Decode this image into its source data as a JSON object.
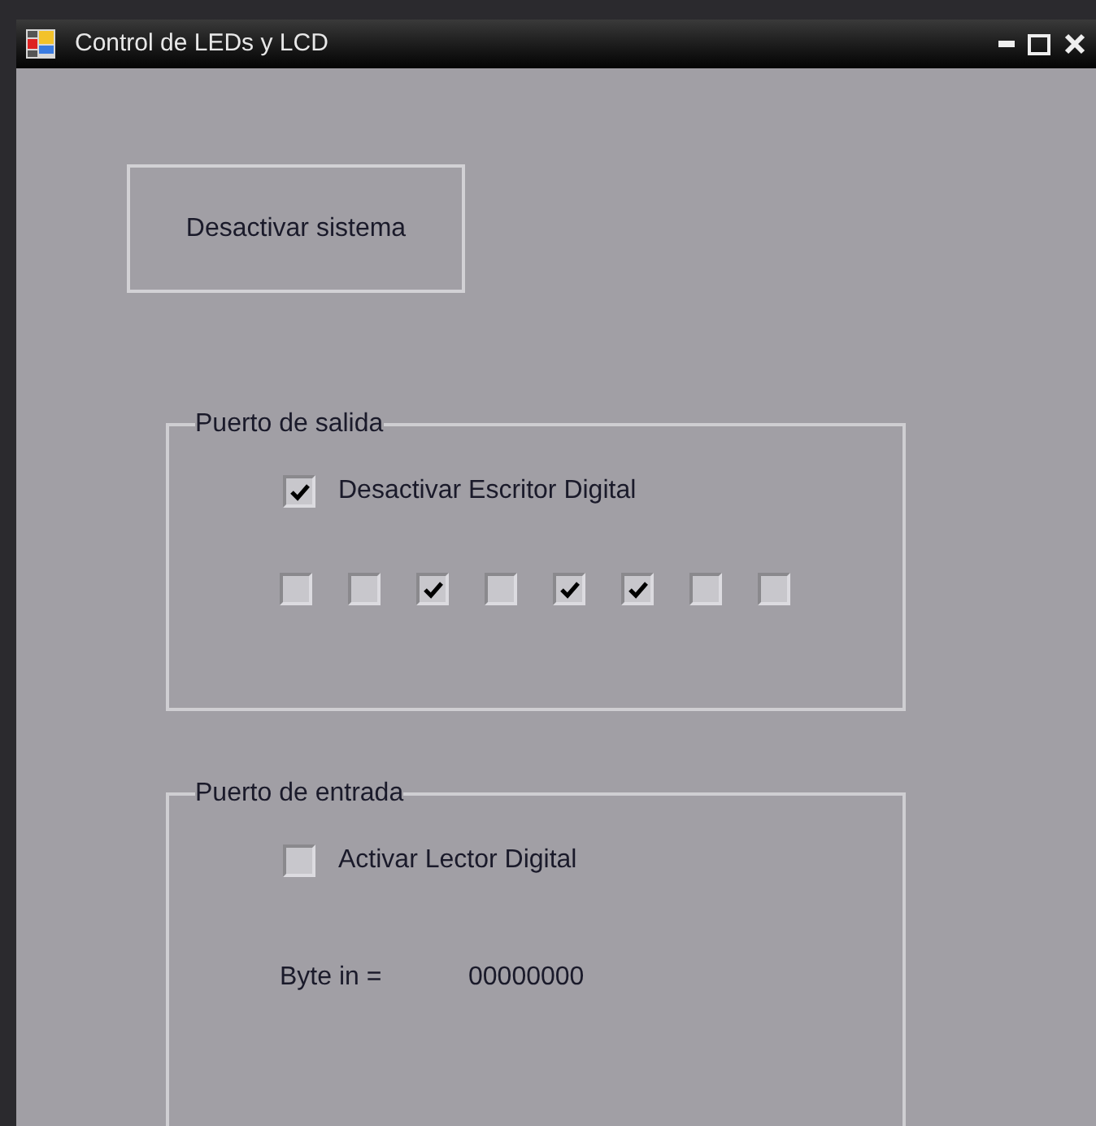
{
  "window": {
    "title": "Control de LEDs y LCD"
  },
  "system_button": {
    "label": "Desactivar sistema"
  },
  "output_group": {
    "title": "Puerto de salida",
    "toggle": {
      "label": "Desactivar Escritor Digital",
      "checked": true
    },
    "bits": [
      {
        "checked": false
      },
      {
        "checked": false
      },
      {
        "checked": true
      },
      {
        "checked": false
      },
      {
        "checked": true
      },
      {
        "checked": true
      },
      {
        "checked": false
      },
      {
        "checked": false
      }
    ]
  },
  "input_group": {
    "title": "Puerto de entrada",
    "toggle": {
      "label": "Activar Lector Digital",
      "checked": false
    },
    "byte_label": "Byte in =",
    "byte_value": "00000000"
  }
}
